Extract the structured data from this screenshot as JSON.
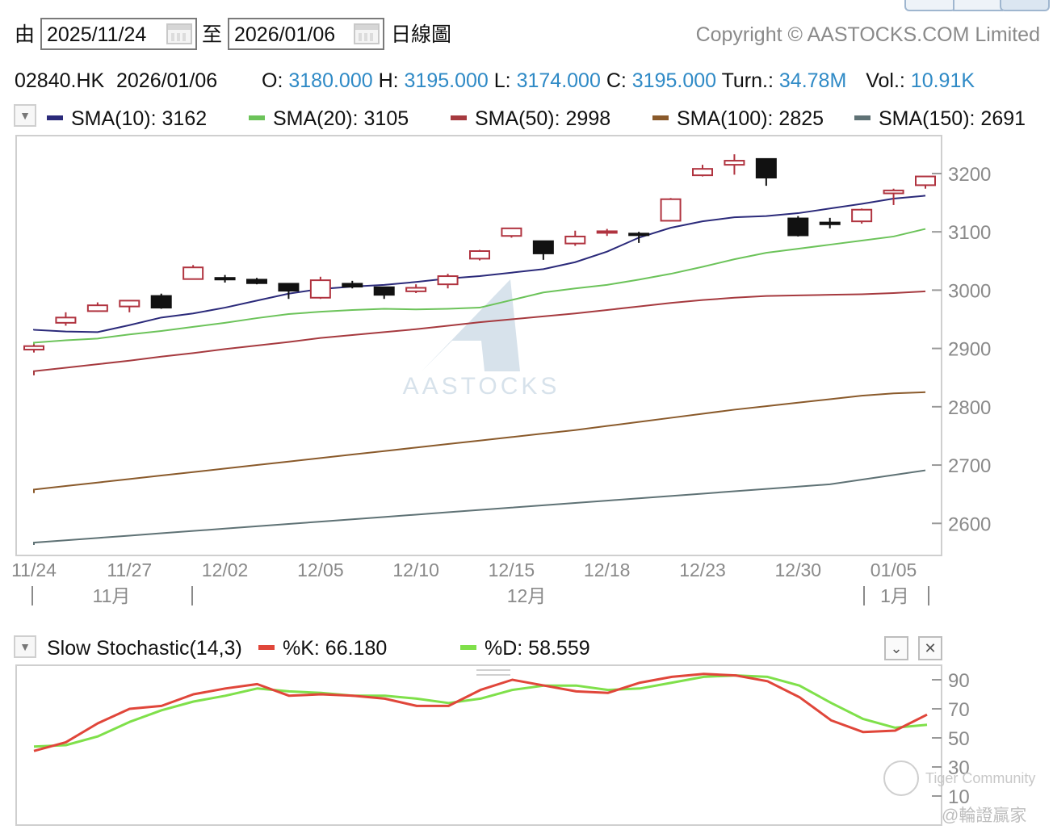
{
  "header": {
    "from_label": "由",
    "from_date": "2025/11/24",
    "to_label": "至",
    "to_date": "2026/01/06",
    "chart_kind": "日線圖",
    "copyright": "Copyright © AASTOCKS.COM Limited"
  },
  "quote": {
    "symbol": "02840.HK",
    "date": "2026/01/06",
    "o_label": "O:",
    "o": "3180.000",
    "h_label": "H:",
    "h": "3195.000",
    "l_label": "L:",
    "l": "3174.000",
    "c_label": "C:",
    "c": "3195.000",
    "turn_label": "Turn.:",
    "turn": "34.78M",
    "vol_label": "Vol.:",
    "vol": "10.91K"
  },
  "sma_legend": [
    {
      "label": "SMA(10): 3162",
      "color": "#2b2a7a"
    },
    {
      "label": "SMA(20): 3105",
      "color": "#6cc35a"
    },
    {
      "label": "SMA(50): 2998",
      "color": "#a63a3f"
    },
    {
      "label": "SMA(100): 2825",
      "color": "#8a5a2b"
    },
    {
      "label": "SMA(150): 2691",
      "color": "#5f7275"
    }
  ],
  "stoch_legend": {
    "title": "Slow Stochastic(14,3)",
    "k_label": "%K: 66.180",
    "k_color": "#e0463a",
    "d_label": "%D: 58.559",
    "d_color": "#7fe04a"
  },
  "watermark": {
    "center": "AASTOCKS",
    "bottom_right_1": "Tiger Community",
    "bottom_right_2": "@輪證贏家"
  },
  "colors": {
    "up": "#b0333f",
    "down": "#111111",
    "price_text": "#2f8ac6"
  },
  "chart_data": [
    {
      "type": "candlestick",
      "title": "",
      "x_tick_labels": [
        "11/24",
        "11/27",
        "12/02",
        "12/05",
        "12/10",
        "12/15",
        "12/18",
        "12/23",
        "12/30",
        "01/05"
      ],
      "month_labels": [
        "11月",
        "12月",
        "1月"
      ],
      "y_ticks": [
        2600,
        2700,
        2800,
        2900,
        3000,
        3100,
        3200
      ],
      "ylim": [
        2545,
        3265
      ],
      "candles": [
        {
          "d": "11/24",
          "o": 2898,
          "h": 2907,
          "l": 2893,
          "c": 2904
        },
        {
          "d": "11/25",
          "o": 2944,
          "h": 2962,
          "l": 2939,
          "c": 2953
        },
        {
          "d": "11/26",
          "o": 2964,
          "h": 2979,
          "l": 2963,
          "c": 2974
        },
        {
          "d": "11/27",
          "o": 2972,
          "h": 2983,
          "l": 2962,
          "c": 2982
        },
        {
          "d": "11/28",
          "o": 2990,
          "h": 2994,
          "l": 2968,
          "c": 2970
        },
        {
          "d": "12/01",
          "o": 3019,
          "h": 3043,
          "l": 3019,
          "c": 3039
        },
        {
          "d": "12/02",
          "o": 3021,
          "h": 3026,
          "l": 3013,
          "c": 3019
        },
        {
          "d": "12/03",
          "o": 3018,
          "h": 3021,
          "l": 3010,
          "c": 3012
        },
        {
          "d": "12/04",
          "o": 3011,
          "h": 3012,
          "l": 2985,
          "c": 2999
        },
        {
          "d": "12/05",
          "o": 2987,
          "h": 3023,
          "l": 2985,
          "c": 3017
        },
        {
          "d": "12/08",
          "o": 3011,
          "h": 3016,
          "l": 3003,
          "c": 3006
        },
        {
          "d": "12/09",
          "o": 3005,
          "h": 3005,
          "l": 2985,
          "c": 2992
        },
        {
          "d": "12/10",
          "o": 2998,
          "h": 3010,
          "l": 2995,
          "c": 3004
        },
        {
          "d": "12/11",
          "o": 3010,
          "h": 3028,
          "l": 3003,
          "c": 3024
        },
        {
          "d": "12/12",
          "o": 3054,
          "h": 3069,
          "l": 3051,
          "c": 3067
        },
        {
          "d": "12/15",
          "o": 3093,
          "h": 3107,
          "l": 3090,
          "c": 3106
        },
        {
          "d": "12/16",
          "o": 3084,
          "h": 3085,
          "l": 3052,
          "c": 3063
        },
        {
          "d": "12/17",
          "o": 3080,
          "h": 3102,
          "l": 3076,
          "c": 3092
        },
        {
          "d": "12/18",
          "o": 3100,
          "h": 3105,
          "l": 3093,
          "c": 3101
        },
        {
          "d": "12/19",
          "o": 3097,
          "h": 3100,
          "l": 3081,
          "c": 3095
        },
        {
          "d": "12/22",
          "o": 3119,
          "h": 3158,
          "l": 3118,
          "c": 3156
        },
        {
          "d": "12/23",
          "o": 3197,
          "h": 3215,
          "l": 3195,
          "c": 3208
        },
        {
          "d": "12/24",
          "o": 3215,
          "h": 3233,
          "l": 3198,
          "c": 3222
        },
        {
          "d": "12/29",
          "o": 3225,
          "h": 3225,
          "l": 3179,
          "c": 3193
        },
        {
          "d": "12/30",
          "o": 3123,
          "h": 3127,
          "l": 3092,
          "c": 3094
        },
        {
          "d": "12/31",
          "o": 3116,
          "h": 3124,
          "l": 3106,
          "c": 3113
        },
        {
          "d": "01/02",
          "o": 3118,
          "h": 3140,
          "l": 3114,
          "c": 3138
        },
        {
          "d": "01/05",
          "o": 3166,
          "h": 3174,
          "l": 3146,
          "c": 3171
        },
        {
          "d": "01/06",
          "o": 3180,
          "h": 3195,
          "l": 3174,
          "c": 3195
        }
      ],
      "series": [
        {
          "name": "SMA(10)",
          "color": "#2b2a7a",
          "values": [
            2930,
            2930,
            2931,
            2932,
            2929,
            2928,
            2940,
            2953,
            2960,
            2970,
            2982,
            2994,
            3002,
            3006,
            3009,
            3014,
            3020,
            3024,
            3030,
            3036,
            3048,
            3066,
            3090,
            3107,
            3118,
            3125,
            3127,
            3132,
            3140,
            3148,
            3157,
            3162
          ]
        },
        {
          "name": "SMA(20)",
          "color": "#6cc35a",
          "values": [
            2899,
            2901,
            2905,
            2910,
            2914,
            2917,
            2924,
            2930,
            2937,
            2944,
            2952,
            2959,
            2963,
            2966,
            2968,
            2967,
            2968,
            2970,
            2983,
            2996,
            3003,
            3009,
            3018,
            3028,
            3040,
            3053,
            3064,
            3071,
            3078,
            3085,
            3092,
            3105
          ]
        },
        {
          "name": "SMA(50)",
          "color": "#a63a3f",
          "values": [
            2842,
            2848,
            2854,
            2861,
            2867,
            2873,
            2879,
            2886,
            2892,
            2899,
            2905,
            2911,
            2918,
            2923,
            2928,
            2933,
            2939,
            2945,
            2950,
            2955,
            2960,
            2966,
            2972,
            2978,
            2983,
            2987,
            2990,
            2991,
            2992,
            2993,
            2995,
            2998
          ]
        },
        {
          "name": "SMA(100)",
          "color": "#8a5a2b",
          "values": [
            2640,
            2646,
            2652,
            2658,
            2664,
            2670,
            2676,
            2682,
            2688,
            2694,
            2700,
            2706,
            2712,
            2718,
            2724,
            2730,
            2736,
            2742,
            2748,
            2754,
            2760,
            2767,
            2774,
            2781,
            2788,
            2795,
            2801,
            2807,
            2813,
            2819,
            2823,
            2825
          ]
        },
        {
          "name": "SMA(150)",
          "color": "#5f7275",
          "values": [
            2555,
            2559,
            2563,
            2567,
            2571,
            2575,
            2579,
            2583,
            2587,
            2591,
            2595,
            2599,
            2603,
            2607,
            2611,
            2615,
            2619,
            2623,
            2627,
            2631,
            2635,
            2639,
            2643,
            2647,
            2651,
            2655,
            2659,
            2663,
            2667,
            2675,
            2683,
            2691
          ]
        }
      ]
    },
    {
      "type": "line",
      "title": "Slow Stochastic(14,3)",
      "y_ticks": [
        10,
        30,
        50,
        70,
        90
      ],
      "ylim": [
        -10,
        100
      ],
      "series": [
        {
          "name": "%K",
          "color": "#e0463a",
          "values": [
            41,
            47,
            60,
            70,
            72,
            80,
            84,
            87,
            79,
            80,
            79,
            77,
            72,
            72,
            83,
            90,
            86,
            82,
            81,
            88,
            92,
            94,
            93,
            89,
            78,
            62,
            54,
            55,
            66
          ]
        },
        {
          "name": "%D",
          "color": "#7fe04a",
          "values": [
            44,
            45,
            51,
            61,
            69,
            75,
            79,
            84,
            82,
            81,
            79,
            79,
            77,
            74,
            77,
            83,
            86,
            86,
            83,
            84,
            88,
            92,
            93,
            92,
            86,
            74,
            63,
            57,
            59
          ]
        }
      ]
    }
  ]
}
